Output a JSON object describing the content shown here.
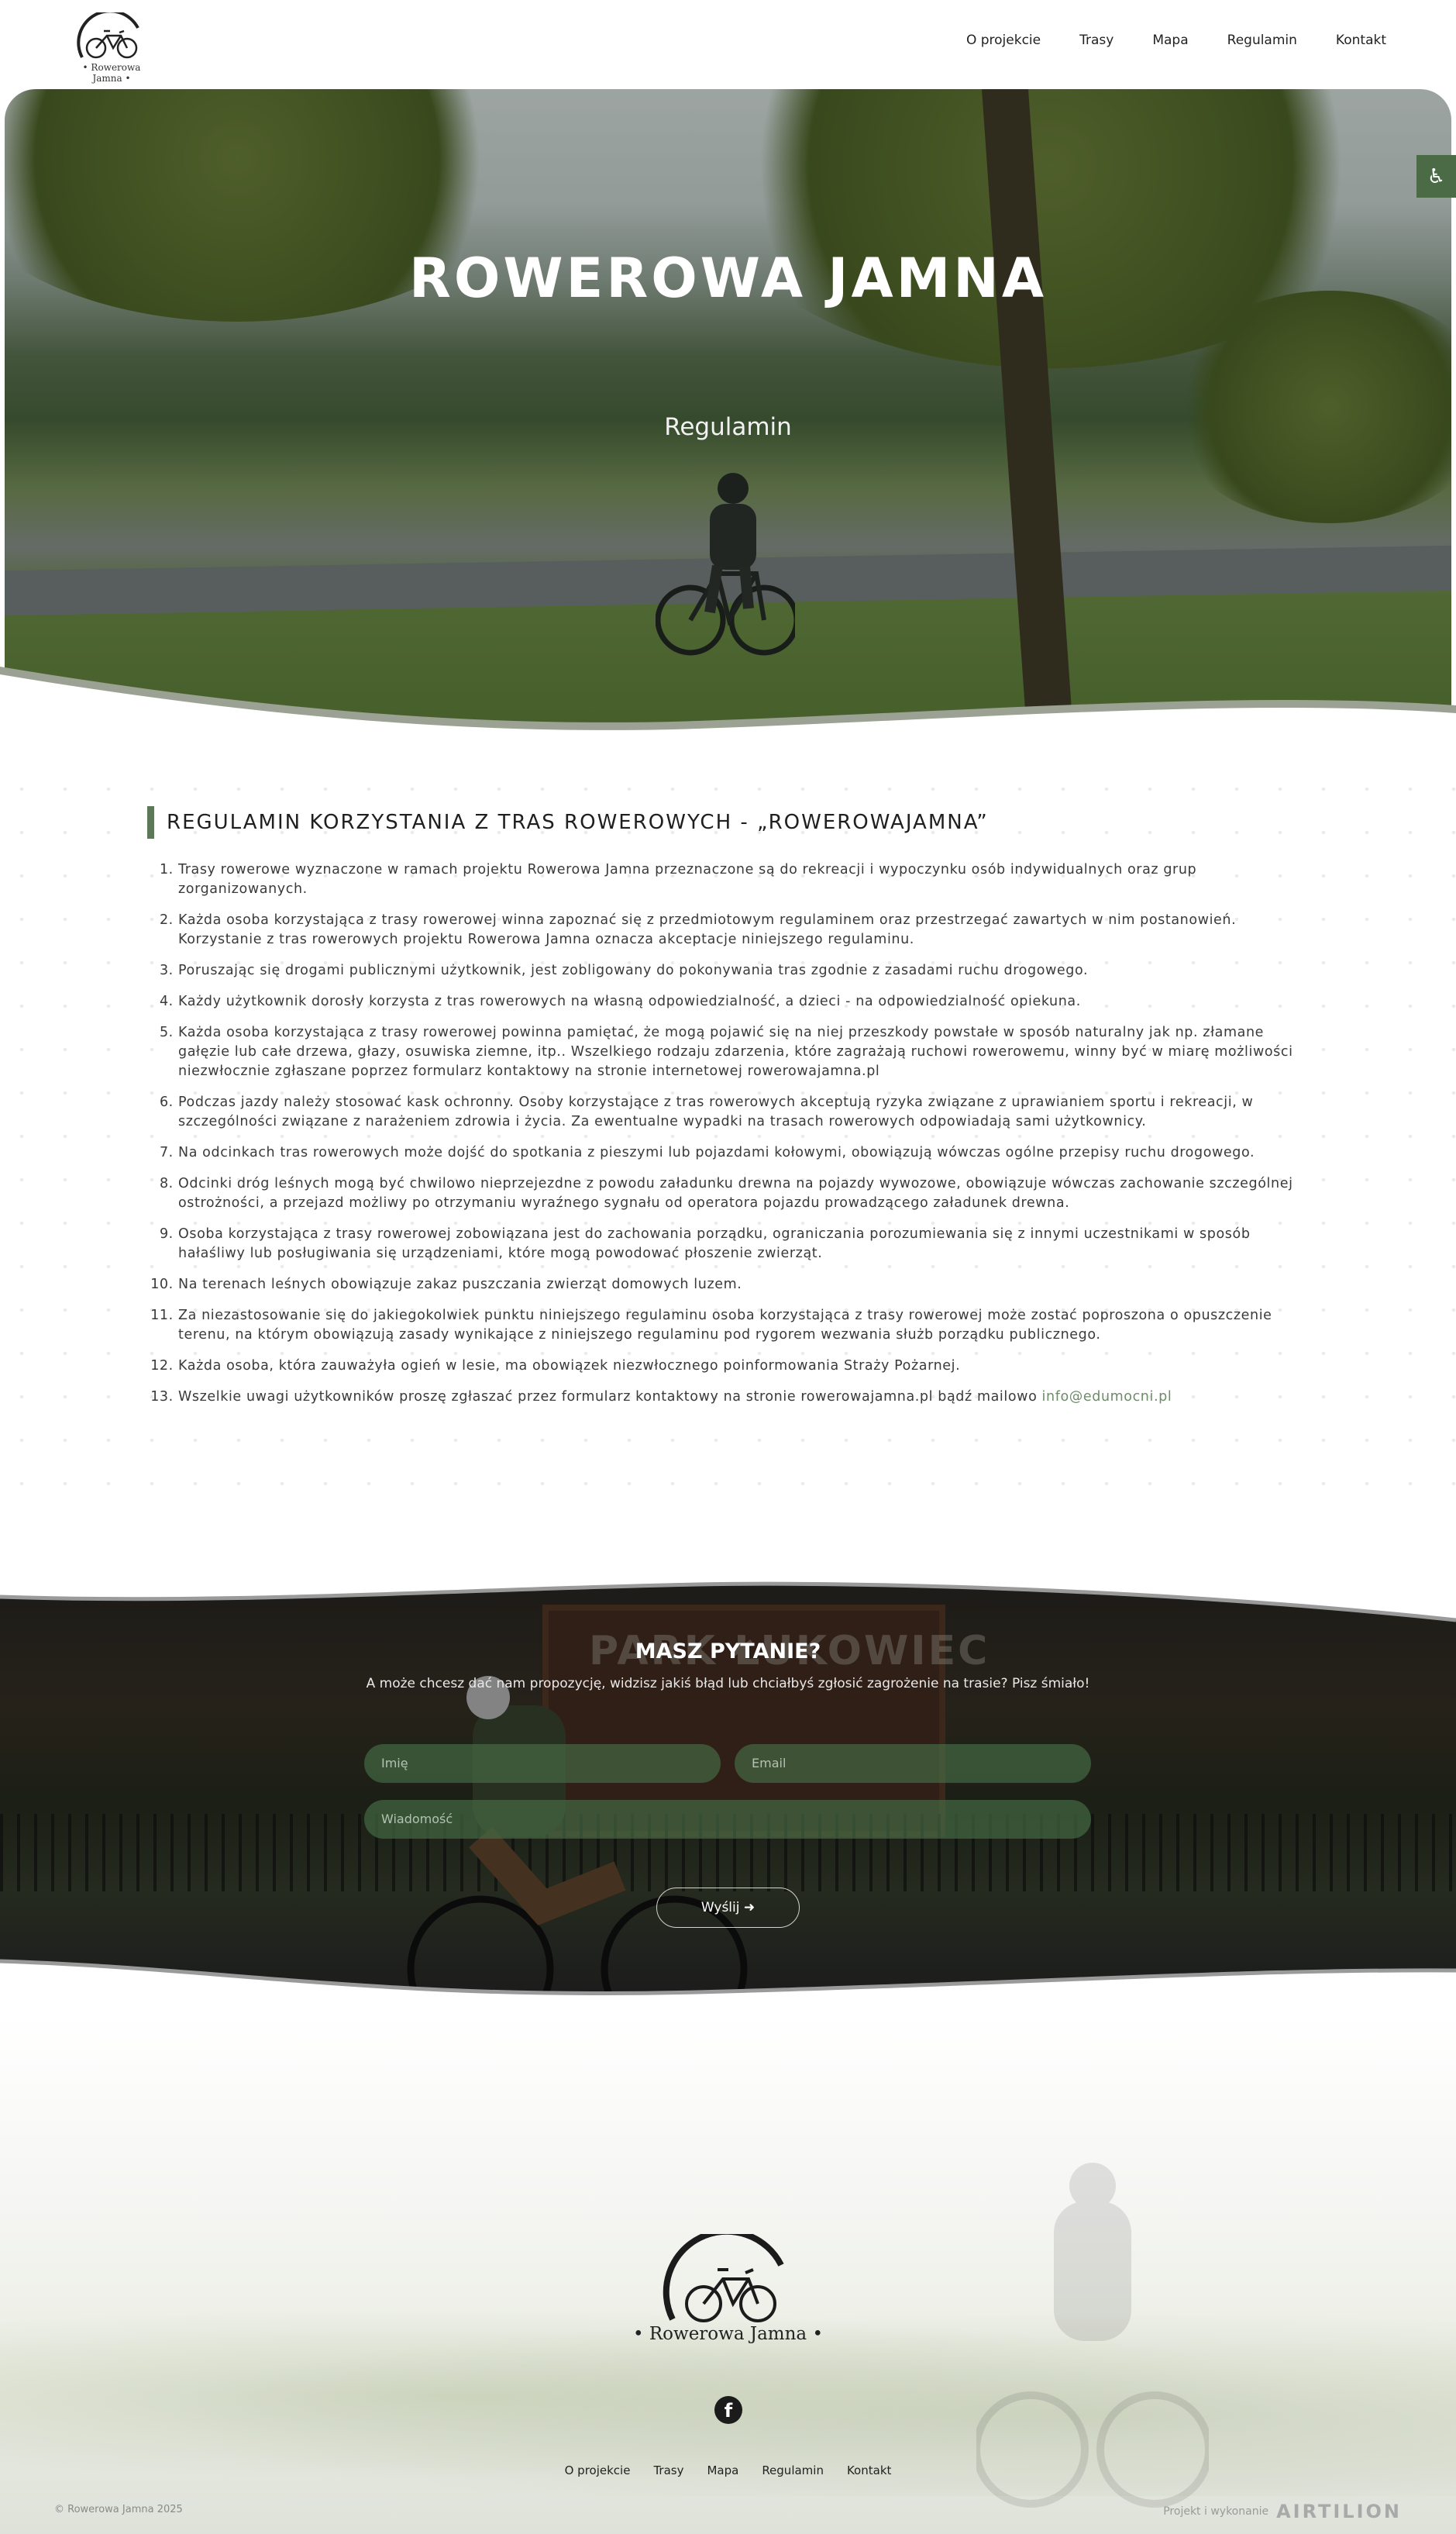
{
  "header": {
    "logo_text": "• Rowerowa Jamna •",
    "nav": [
      "O projekcie",
      "Trasy",
      "Mapa",
      "Regulamin",
      "Kontakt"
    ]
  },
  "hero": {
    "title": "ROWEROWA JAMNA",
    "subtitle": "Regulamin"
  },
  "accessibility": {
    "icon": "accessibility-icon"
  },
  "regulations": {
    "title": "REGULAMIN KORZYSTANIA Z TRAS ROWEROWYCH - „ROWEROWAJAMNA”",
    "items": [
      "Trasy rowerowe wyznaczone w ramach projektu Rowerowa Jamna przeznaczone są do rekreacji i wypoczynku osób indywidualnych oraz grup zorganizowanych.",
      "Każda osoba korzystająca z trasy rowerowej winna zapoznać się z przedmiotowym regulaminem oraz przestrzegać zawartych w nim postanowień. Korzystanie z tras rowerowych projektu Rowerowa Jamna oznacza akceptacje niniejszego regulaminu.",
      "Poruszając się drogami publicznymi użytkownik, jest zobligowany do pokonywania tras zgodnie z zasadami ruchu drogowego.",
      "Każdy użytkownik dorosły korzysta z tras rowerowych na własną odpowiedzialność, a dzieci - na odpowiedzialność opiekuna.",
      "Każda osoba korzystająca z trasy rowerowej powinna pamiętać, że mogą pojawić się na niej przeszkody powstałe w sposób naturalny jak np. złamane gałęzie lub całe drzewa, głazy, osuwiska ziemne, itp.. Wszelkiego rodzaju zdarzenia, które zagrażają ruchowi rowerowemu, winny być w miarę możliwości niezwłocznie zgłaszane poprzez formularz kontaktowy na stronie internetowej rowerowajamna.pl",
      "Podczas jazdy należy stosować kask ochronny. Osoby korzystające z tras rowerowych akceptują ryzyka związane z uprawianiem sportu i rekreacji, w szczególności związane z narażeniem zdrowia i życia. Za ewentualne wypadki na trasach rowerowych odpowiadają sami użytkownicy.",
      "Na odcinkach tras rowerowych może dojść do spotkania z pieszymi lub pojazdami kołowymi, obowiązują wówczas ogólne przepisy ruchu drogowego.",
      "Odcinki dróg leśnych mogą być chwilowo nieprzejezdne z powodu załadunku drewna na pojazdy wywozowe, obowiązuje wówczas zachowanie szczególnej ostrożności, a przejazd możliwy po otrzymaniu wyraźnego sygnału od operatora pojazdu prowadzącego załadunek drewna.",
      "Osoba korzystająca z trasy rowerowej zobowiązana jest do zachowania porządku, ograniczania porozumiewania się z innymi uczestnikami w sposób hałaśliwy lub posługiwania się urządzeniami, które mogą powodować płoszenie zwierząt.",
      "Na terenach leśnych obowiązuje zakaz puszczania zwierząt domowych luzem.",
      "Za niezastosowanie się do jakiegokolwiek punktu niniejszego regulaminu osoba korzystająca z trasy rowerowej może zostać poproszona o opuszczenie terenu, na którym obowiązują zasady wynikające z niniejszego regulaminu pod rygorem wezwania służb porządku publicznego.",
      "Każda osoba, która zauważyła ogień w lesie, ma obowiązek niezwłocznego poinformowania Straży Pożarnej.",
      "Wszelkie uwagi użytkowników proszę zgłaszać przez formularz kontaktowy na stronie rowerowajamna.pl bądź mailowo "
    ],
    "email": "info@edumocni.pl"
  },
  "contact": {
    "title": "MASZ PYTANIE?",
    "subtitle": "A może chcesz dać nam propozycję, widzisz jakiś błąd lub chciałbyś zgłosić zagrożenie na trasie? Pisz śmiało!",
    "sign_text": "PARK ŁUKOWIEC",
    "name_placeholder": "Imię",
    "email_placeholder": "Email",
    "message_placeholder": "Wiadomość",
    "send_label": "Wyślij ➜"
  },
  "footer": {
    "logo_text": "• Rowerowa Jamna •",
    "social_icon": "facebook-icon",
    "nav": [
      "O projekcie",
      "Trasy",
      "Mapa",
      "Regulamin",
      "Kontakt"
    ],
    "copyright": "© Rowerowa Jamna 2025",
    "credit_label": "Projekt i wykonanie",
    "credit_brand": "AIRTILION"
  },
  "colors": {
    "accent_green": "#5d7858",
    "email_link": "#6e8b6a",
    "accessibility_bg": "#4a6b46"
  }
}
